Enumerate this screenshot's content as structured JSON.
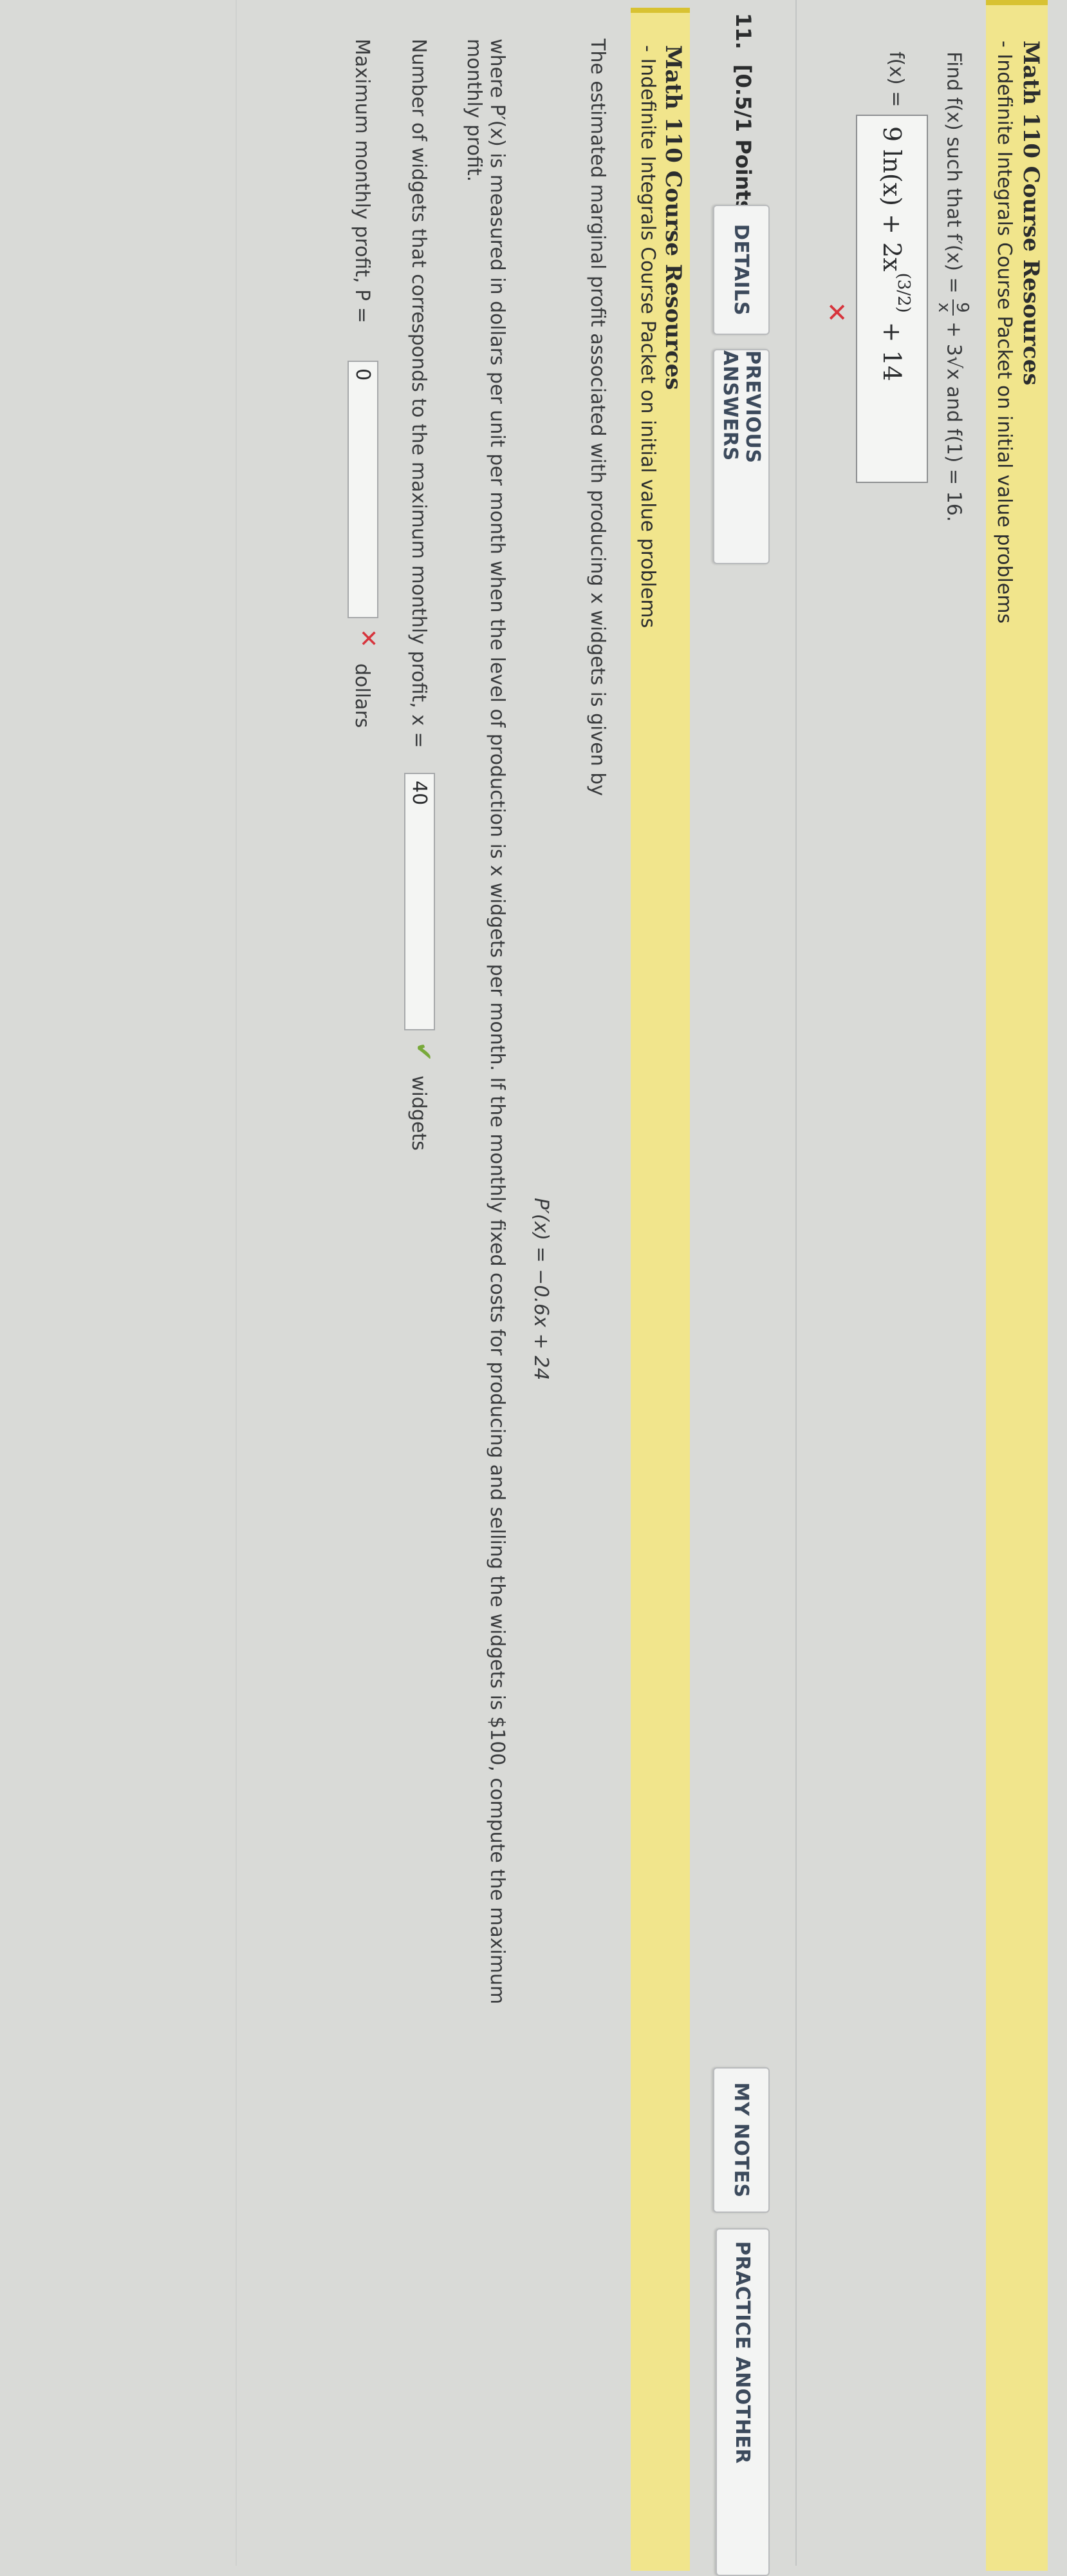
{
  "prev_question": {
    "resource_title": "Math 110 Course Resources",
    "resource_link": "- Indefinite Integrals Course Packet on initial value problems",
    "prompt_prefix": "Find f(x) such that f′(x) = ",
    "prompt_frac_num": "9",
    "prompt_frac_den": "x",
    "prompt_rest": " + 3√x and f(1) = 16.",
    "answer_label": "f(x) = ",
    "answer_value": "9 ln(x) + 2x^(3/2) + 14",
    "answer_part1": "9 ln(x) + 2x",
    "answer_exp": "(3/2)",
    "answer_part2": "+ 14",
    "status_icon": "x-mark-icon"
  },
  "question": {
    "number": "11.",
    "points": "[0.5/1 Points]",
    "buttons": {
      "details": "DETAILS",
      "previous_answers": "PREVIOUS ANSWERS",
      "my_notes": "MY NOTES",
      "practice_another": "PRACTICE ANOTHER"
    },
    "resource_title": "Math 110 Course Resources",
    "resource_link": "- Indefinite Integrals Course Packet on initial value problems",
    "intro": "The estimated marginal profit associated with producing x widgets is given by",
    "formula": "P′(x) = −0.6x + 24",
    "body_line1": "where P′(x) is measured in dollars per unit per month when the level of production is x widgets per month. If the monthly fixed costs for producing and selling the widgets is $100, compute the maximum",
    "body_line2": "monthly profit.",
    "part1_label": "Number of widgets that corresponds to the maximum monthly profit, x = ",
    "part1_value": "40",
    "part1_unit": "widgets",
    "part1_status": "check-mark-icon",
    "part2_label": "Maximum monthly profit, P = ",
    "part2_value": "0",
    "part2_unit": "dollars",
    "part2_status": "x-mark-icon"
  },
  "colors": {
    "resource_bg": "#f1e58c",
    "wrong": "#d7343c",
    "correct": "#78a93a",
    "button_text": "#3c4a5c"
  }
}
